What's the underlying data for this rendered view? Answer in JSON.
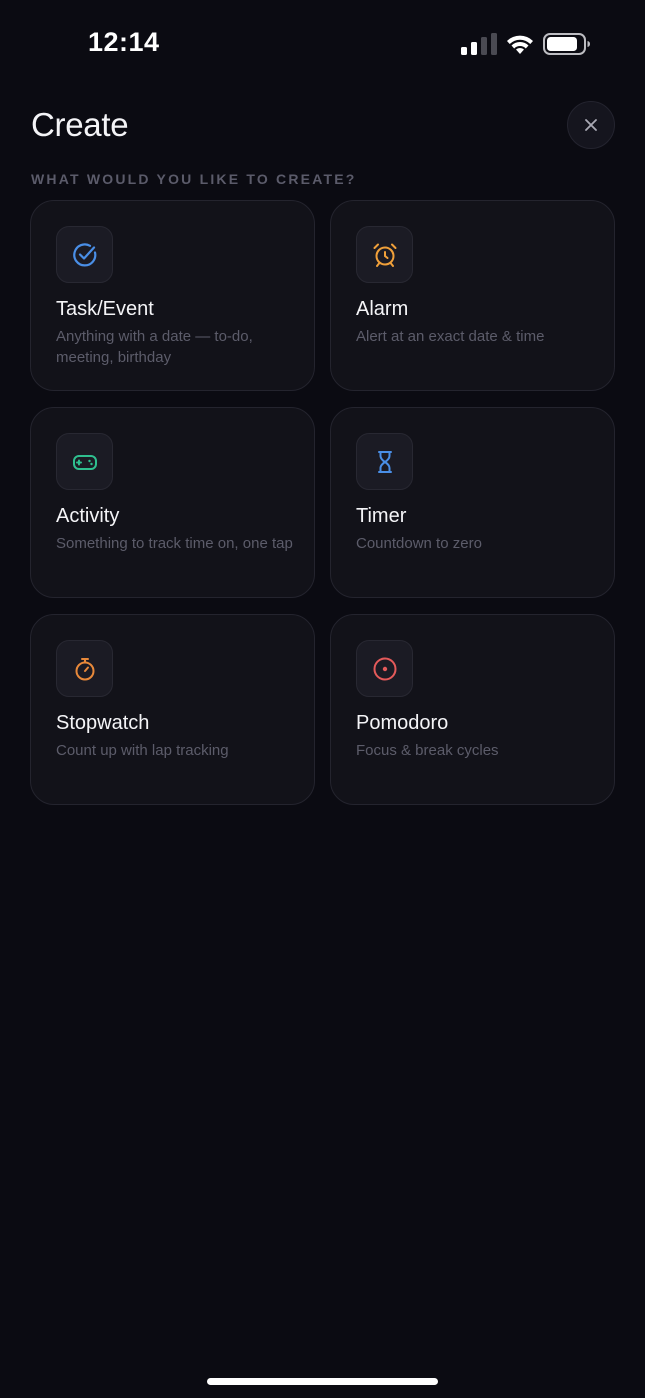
{
  "status_bar": {
    "time": "12:14",
    "signal_icon": "cellular-signal-icon",
    "wifi_icon": "wifi-icon",
    "battery_icon": "battery-icon"
  },
  "header": {
    "title": "Create",
    "close_icon": "close-icon"
  },
  "section_label": "WHAT WOULD YOU LIKE TO CREATE?",
  "cards": [
    {
      "title": "Task/Event",
      "description": "Anything with a date — to-do, meeting, birthday",
      "icon": "check-circle-icon",
      "accent": "#4a8fe7"
    },
    {
      "title": "Alarm",
      "description": "Alert at an exact date & time",
      "icon": "alarm-clock-icon",
      "accent": "#f0a03a"
    },
    {
      "title": "Activity",
      "description": "Something to track time on, one tap",
      "icon": "gamepad-icon",
      "accent": "#2fbf8f"
    },
    {
      "title": "Timer",
      "description": "Countdown to zero",
      "icon": "hourglass-icon",
      "accent": "#4a8fe7"
    },
    {
      "title": "Stopwatch",
      "description": "Count up with lap tracking",
      "icon": "stopwatch-icon",
      "accent": "#e8893a"
    },
    {
      "title": "Pomodoro",
      "description": "Focus & break cycles",
      "icon": "target-circle-icon",
      "accent": "#e45a5a"
    }
  ],
  "colors": {
    "background": "#0b0b12",
    "card": "#121219",
    "card_border": "#24242e",
    "muted_text": "#5c5c6a"
  }
}
